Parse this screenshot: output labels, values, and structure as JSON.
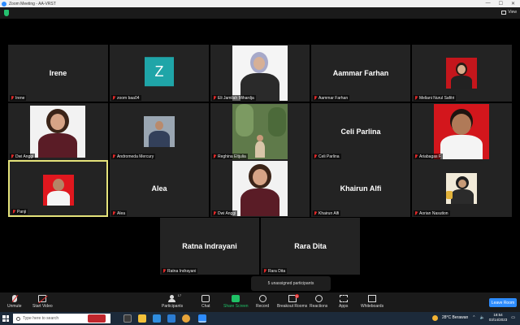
{
  "window": {
    "title": "Zoom Meeting - AA-VRST",
    "controls": [
      "—",
      "☐",
      "✕"
    ]
  },
  "meeting": {
    "view_label": "View"
  },
  "tiles": [
    {
      "big": "Irene",
      "label": "Irene"
    },
    {
      "big": "",
      "label": "zoom baa04",
      "avatar": "Z"
    },
    {
      "big": "",
      "label": "Eli Jamilah Mihardja"
    },
    {
      "big": "Aammar Farhan",
      "label": "Aammar Farhan"
    },
    {
      "big": "",
      "label": "Meliani Nurul Safitri"
    },
    {
      "big": "",
      "label": "Dwi Anggi"
    },
    {
      "big": "",
      "label": "Andromeda Mercury"
    },
    {
      "big": "",
      "label": "Reghina Eltjulia"
    },
    {
      "big": "Celi Parlina",
      "label": "Celi Parlina"
    },
    {
      "big": "",
      "label": "Ariabagas F"
    },
    {
      "big": "",
      "label": "Panji"
    },
    {
      "big": "Alea",
      "label": "Alea"
    },
    {
      "big": "",
      "label": "Dwi Anggi"
    },
    {
      "big": "Khairun Alfi",
      "label": "Khairun Alfi"
    },
    {
      "big": "",
      "label": "Aorian Nasution"
    },
    {
      "big": "Ratna Indrayani",
      "label": "Ratna Indrayani"
    },
    {
      "big": "Rara Dita",
      "label": "Rara Dita"
    }
  ],
  "tooltip": "5 unassigned participants",
  "toolbar": {
    "unmute": "Unmute",
    "start_video": "Start Video",
    "participants": "Participants",
    "participants_count": "17",
    "chat": "Chat",
    "share_screen": "Share Screen",
    "record": "Record",
    "breakout_rooms": "Breakout Rooms",
    "breakout_badge": "5",
    "reactions": "Reactions",
    "apps": "Apps",
    "whiteboards": "Whiteboards",
    "leave": "Leave Room"
  },
  "taskbar": {
    "search_placeholder": "Type here to search",
    "weather": "28°C Berawan",
    "time": "18:54",
    "date": "03/14/2023"
  },
  "colors": {
    "accent": "#2d8cff",
    "share": "#1fc166",
    "active_border": "#e4e27a"
  }
}
